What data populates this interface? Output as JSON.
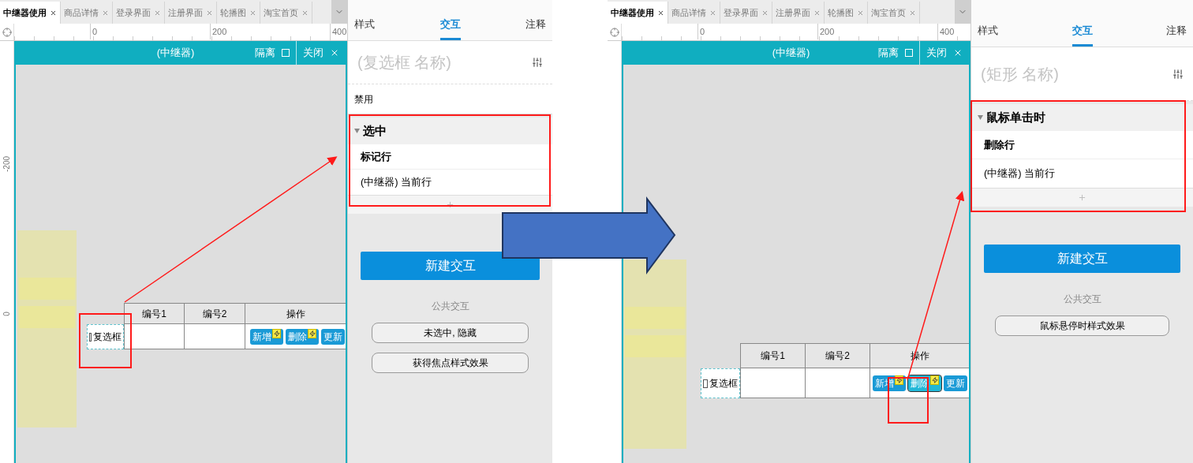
{
  "screens": [
    {
      "doc_tabs": [
        {
          "label": "中继器使用",
          "selected": true
        },
        {
          "label": "商品详情",
          "selected": false
        },
        {
          "label": "登录界面",
          "selected": false
        },
        {
          "label": "注册界面",
          "selected": false
        },
        {
          "label": "轮播图",
          "selected": false
        },
        {
          "label": "淘宝首页",
          "selected": false
        }
      ],
      "ruler_labels": [
        "0",
        "200",
        "400"
      ],
      "vruler_labels": [
        "-200",
        "0"
      ],
      "repeater": {
        "title": "(中继器)",
        "isolate": "隔离",
        "close": "关闭"
      },
      "table": {
        "columns": [
          "编号1",
          "编号2",
          "操作"
        ],
        "checkbox": {
          "label": "复选框",
          "checked": false
        },
        "buttons": [
          {
            "label": "新增",
            "selected": false
          },
          {
            "label": "删除",
            "selected": false
          },
          {
            "label": "更新",
            "selected": false
          }
        ]
      },
      "inspector": {
        "tabs": [
          {
            "label": "样式",
            "selected": false
          },
          {
            "label": "交互",
            "selected": true
          },
          {
            "label": "注释",
            "selected": false
          }
        ],
        "name_placeholder": "(复选框 名称)",
        "rows": [
          "禁用"
        ],
        "event": {
          "title": "选中",
          "expanded": true,
          "action": "标记行",
          "target": "(中继器) 当前行"
        },
        "new_button": "新建交互",
        "common_title": "公共交互",
        "common_buttons": [
          "未选中, 隐藏",
          "获得焦点样式效果"
        ]
      }
    },
    {
      "doc_tabs": [
        {
          "label": "中继器使用",
          "selected": true
        },
        {
          "label": "商品详情",
          "selected": false
        },
        {
          "label": "登录界面",
          "selected": false
        },
        {
          "label": "注册界面",
          "selected": false
        },
        {
          "label": "轮播图",
          "selected": false
        },
        {
          "label": "淘宝首页",
          "selected": false
        }
      ],
      "ruler_labels": [
        "0",
        "200",
        "400"
      ],
      "repeater": {
        "title": "(中继器)",
        "isolate": "隔离",
        "close": "关闭"
      },
      "table": {
        "columns": [
          "编号1",
          "编号2",
          "操作"
        ],
        "checkbox": {
          "label": "复选框",
          "checked": false
        },
        "buttons": [
          {
            "label": "新增",
            "selected": false
          },
          {
            "label": "删除",
            "selected": true
          },
          {
            "label": "更新",
            "selected": false
          }
        ]
      },
      "inspector": {
        "tabs": [
          {
            "label": "样式",
            "selected": false
          },
          {
            "label": "交互",
            "selected": true
          },
          {
            "label": "注释",
            "selected": false
          }
        ],
        "name_placeholder": "(矩形 名称)",
        "event": {
          "title": "鼠标单击时",
          "expanded": true,
          "action": "删除行",
          "target": "(中继器) 当前行"
        },
        "new_button": "新建交互",
        "common_title": "公共交互",
        "common_buttons": [
          "鼠标悬停时样式效果"
        ]
      }
    }
  ]
}
